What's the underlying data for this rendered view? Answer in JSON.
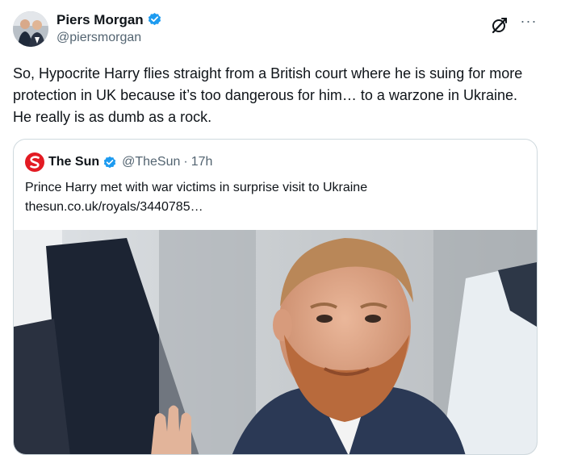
{
  "tweet": {
    "author": {
      "name": "Piers Morgan",
      "handle": "@piersmorgan",
      "avatar_icon": "avatar-photo"
    },
    "verified_icon": "verified-badge-icon",
    "actions": {
      "grok_icon": "grok-icon",
      "more_label": "···"
    },
    "text": "So, Hypocrite Harry flies straight from a British court where he is suing for more protection in UK because it’s too dangerous for him… to a warzone in Ukraine. He really is as dumb as a rock."
  },
  "quote": {
    "name": "The Sun",
    "handle": "@TheSun",
    "time_sep": "·",
    "time": "17h",
    "headline": "Prince Harry met with war victims in surprise visit to Ukraine",
    "link": "thesun.co.uk/royals/3440785…",
    "image_icon": "news-photo"
  },
  "colors": {
    "text": "#0f1419",
    "secondary": "#536471",
    "verified": "#1d9bf0",
    "border": "#cfd9de",
    "sun_red": "#e31b23"
  }
}
